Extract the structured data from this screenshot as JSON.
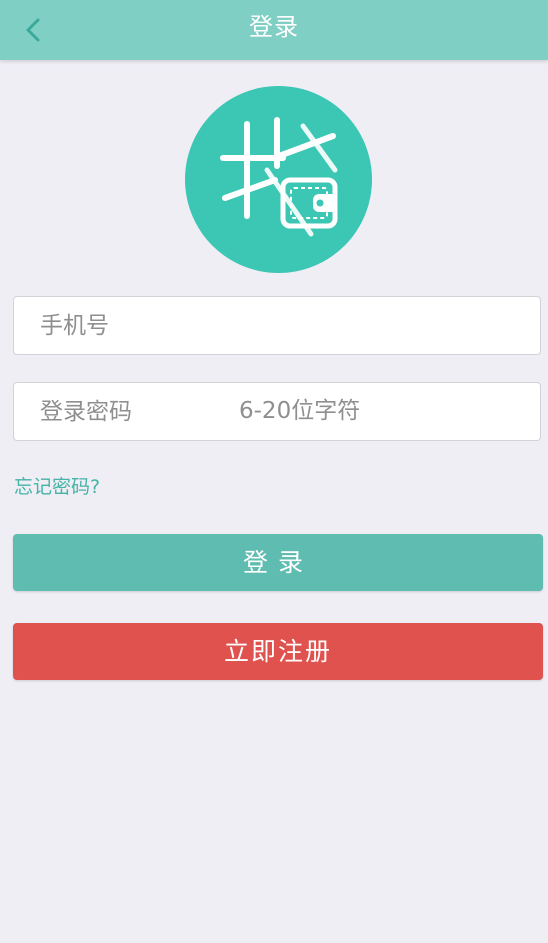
{
  "header": {
    "title": "登录",
    "back_icon": "chevron-left-icon"
  },
  "logo": {
    "glyph": "指",
    "icon": "wallet-icon",
    "color": "#3cc6b4"
  },
  "form": {
    "phone_placeholder": "手机号",
    "password_placeholder": "登录密码",
    "password_hint": "6-20位字符"
  },
  "forgot_password": "忘记密码?",
  "buttons": {
    "login": "登录",
    "register": "立即注册"
  },
  "colors": {
    "header": "#7fcfc4",
    "login_button": "#5fbcb1",
    "register_button": "#df524d",
    "link": "#45b3a6",
    "background": "#efeef5"
  }
}
